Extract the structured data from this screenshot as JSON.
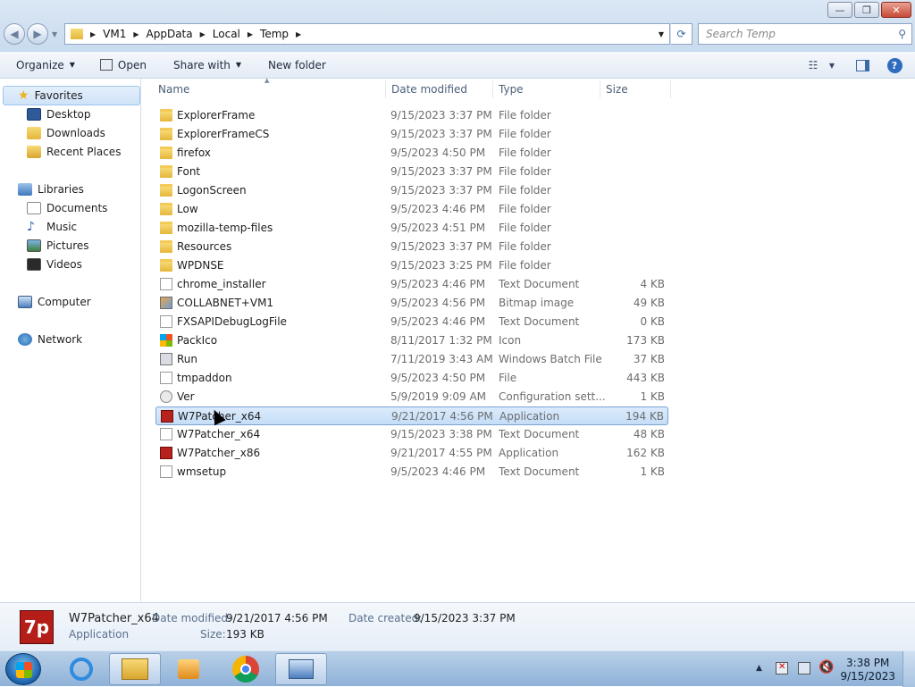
{
  "window": {
    "min": "—",
    "max": "❐",
    "close": "✕"
  },
  "address": {
    "crumbs": [
      "VM1",
      "AppData",
      "Local",
      "Temp"
    ],
    "search_placeholder": "Search Temp"
  },
  "toolbar": {
    "organize": "Organize",
    "open": "Open",
    "share_with": "Share with",
    "new_folder": "New folder"
  },
  "nav": {
    "favorites": "Favorites",
    "desktop": "Desktop",
    "downloads": "Downloads",
    "recent_places": "Recent Places",
    "libraries": "Libraries",
    "documents": "Documents",
    "music": "Music",
    "pictures": "Pictures",
    "videos": "Videos",
    "computer": "Computer",
    "network": "Network"
  },
  "columns": {
    "name": "Name",
    "date": "Date modified",
    "type": "Type",
    "size": "Size"
  },
  "files": [
    {
      "name": "ExplorerFrame",
      "date": "9/15/2023 3:37 PM",
      "type": "File folder",
      "size": "",
      "icon": "folder"
    },
    {
      "name": "ExplorerFrameCS",
      "date": "9/15/2023 3:37 PM",
      "type": "File folder",
      "size": "",
      "icon": "folder"
    },
    {
      "name": "firefox",
      "date": "9/5/2023 4:50 PM",
      "type": "File folder",
      "size": "",
      "icon": "folder"
    },
    {
      "name": "Font",
      "date": "9/15/2023 3:37 PM",
      "type": "File folder",
      "size": "",
      "icon": "folder"
    },
    {
      "name": "LogonScreen",
      "date": "9/15/2023 3:37 PM",
      "type": "File folder",
      "size": "",
      "icon": "folder"
    },
    {
      "name": "Low",
      "date": "9/5/2023 4:46 PM",
      "type": "File folder",
      "size": "",
      "icon": "folder"
    },
    {
      "name": "mozilla-temp-files",
      "date": "9/5/2023 4:51 PM",
      "type": "File folder",
      "size": "",
      "icon": "folder"
    },
    {
      "name": "Resources",
      "date": "9/15/2023 3:37 PM",
      "type": "File folder",
      "size": "",
      "icon": "folder"
    },
    {
      "name": "WPDNSE",
      "date": "9/15/2023 3:25 PM",
      "type": "File folder",
      "size": "",
      "icon": "folder"
    },
    {
      "name": "chrome_installer",
      "date": "9/5/2023 4:46 PM",
      "type": "Text Document",
      "size": "4 KB",
      "icon": "doc"
    },
    {
      "name": "COLLABNET+VM1",
      "date": "9/5/2023 4:56 PM",
      "type": "Bitmap image",
      "size": "49 KB",
      "icon": "bmp"
    },
    {
      "name": "FXSAPIDebugLogFile",
      "date": "9/5/2023 4:46 PM",
      "type": "Text Document",
      "size": "0 KB",
      "icon": "doc"
    },
    {
      "name": "PackIco",
      "date": "8/11/2017 1:32 PM",
      "type": "Icon",
      "size": "173 KB",
      "icon": "wico"
    },
    {
      "name": "Run",
      "date": "7/11/2019 3:43 AM",
      "type": "Windows Batch File",
      "size": "37 KB",
      "icon": "bat"
    },
    {
      "name": "tmpaddon",
      "date": "9/5/2023 4:50 PM",
      "type": "File",
      "size": "443 KB",
      "icon": "doc"
    },
    {
      "name": "Ver",
      "date": "5/9/2019 9:09 AM",
      "type": "Configuration sett...",
      "size": "1 KB",
      "icon": "cfg"
    },
    {
      "name": "W7Patcher_x64",
      "date": "9/21/2017 4:56 PM",
      "type": "Application",
      "size": "194 KB",
      "icon": "app",
      "selected": true
    },
    {
      "name": "W7Patcher_x64",
      "date": "9/15/2023 3:38 PM",
      "type": "Text Document",
      "size": "48 KB",
      "icon": "doc"
    },
    {
      "name": "W7Patcher_x86",
      "date": "9/21/2017 4:55 PM",
      "type": "Application",
      "size": "162 KB",
      "icon": "app"
    },
    {
      "name": "wmsetup",
      "date": "9/5/2023 4:46 PM",
      "type": "Text Document",
      "size": "1 KB",
      "icon": "doc"
    }
  ],
  "details": {
    "icon_text": "7p",
    "name": "W7Patcher_x64",
    "kind": "Application",
    "date_modified_label": "Date modified:",
    "date_modified": "9/21/2017 4:56 PM",
    "date_created_label": "Date created:",
    "date_created": "9/15/2023 3:37 PM",
    "size_label": "Size:",
    "size": "193 KB"
  },
  "taskbar": {
    "time": "3:38 PM",
    "date": "9/15/2023"
  }
}
